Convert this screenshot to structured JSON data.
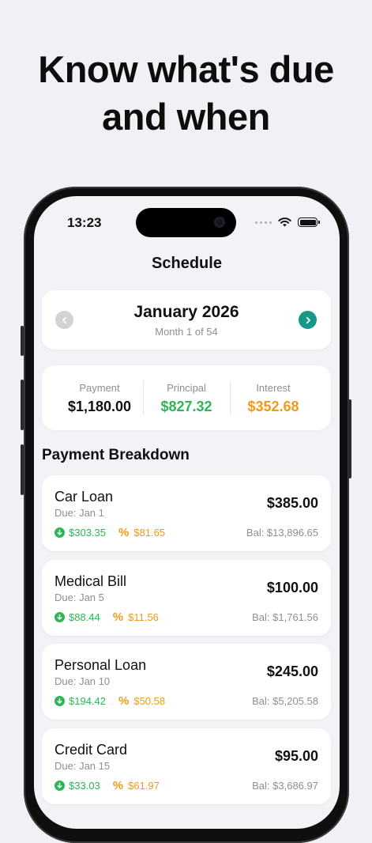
{
  "headline": {
    "line1": "Know what's due",
    "line2": "and when"
  },
  "status_bar": {
    "time": "13:23"
  },
  "nav": {
    "title": "Schedule"
  },
  "month": {
    "title": "January 2026",
    "subtitle": "Month 1 of 54"
  },
  "summary": {
    "payment": {
      "label": "Payment",
      "value": "$1,180.00"
    },
    "principal": {
      "label": "Principal",
      "value": "$827.32"
    },
    "interest": {
      "label": "Interest",
      "value": "$352.68"
    }
  },
  "breakdown": {
    "title": "Payment Breakdown",
    "items": [
      {
        "name": "Car Loan",
        "due": "Due: Jan 1",
        "amount": "$385.00",
        "principal": "$303.35",
        "interest": "$81.65",
        "balance": "Bal: $13,896.65"
      },
      {
        "name": "Medical Bill",
        "due": "Due: Jan 5",
        "amount": "$100.00",
        "principal": "$88.44",
        "interest": "$11.56",
        "balance": "Bal: $1,761.56"
      },
      {
        "name": "Personal Loan",
        "due": "Due: Jan 10",
        "amount": "$245.00",
        "principal": "$194.42",
        "interest": "$50.58",
        "balance": "Bal: $5,205.58"
      },
      {
        "name": "Credit Card",
        "due": "Due: Jan 15",
        "amount": "$95.00",
        "principal": "$33.03",
        "interest": "$61.97",
        "balance": "Bal: $3,686.97"
      }
    ]
  },
  "colors": {
    "principal": "#2fb556",
    "interest": "#f09a1a",
    "accent": "#17978a",
    "muted": "#8e8e93"
  },
  "icons": {
    "prev": "chevron-left-icon",
    "next": "chevron-right-icon",
    "principal": "arrow-down-circle-icon",
    "interest": "percent-icon",
    "wifi": "wifi-icon",
    "battery": "battery-icon"
  }
}
